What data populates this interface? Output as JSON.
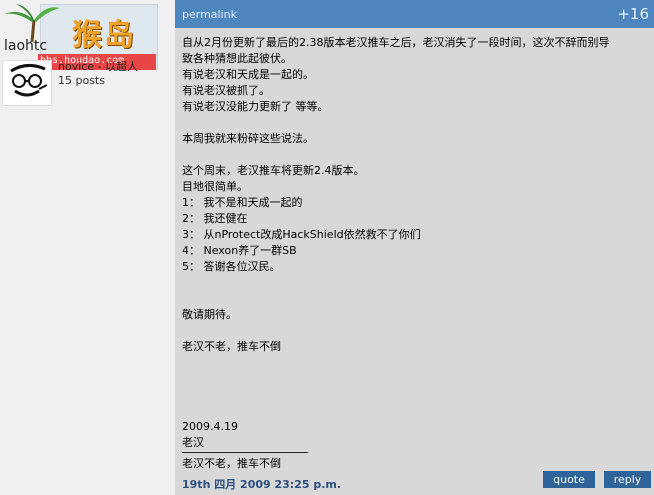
{
  "watermark": {
    "logo_text": "猴岛",
    "url": "bbs.houdao.com"
  },
  "user": {
    "name": "laohtc",
    "rank": "novice - 以超人",
    "posts": "15 posts"
  },
  "header": {
    "permalink": "permalink",
    "score": "+16"
  },
  "post": {
    "lines": [
      "自从2月份更新了最后的2.38版本老汉推车之后，老汉消失了一段时间，这次不辞而别导",
      "致各种猜想此起彼伏。",
      "有说老汉和天成是一起的。",
      "有说老汉被抓了。",
      "有说老汉没能力更新了 等等。",
      "",
      "本周我就来粉碎这些说法。",
      "",
      "这个周末，老汉推车将更新2.4版本。",
      "目地很简单。",
      "1： 我不是和天成一起的",
      "2： 我还健在",
      "3： 从nProtect改成HackShield依然救不了你们",
      "4： Nexon养了一群SB",
      "5： 答谢各位汉民。",
      "",
      "",
      "敬请期待。",
      "",
      "老汉不老，推车不倒",
      "",
      "",
      "",
      "",
      "2009.4.19",
      "老汉"
    ],
    "signature": "老汉不老，推车不倒",
    "date": "19th 四月  2009 23:25 p.m."
  },
  "buttons": {
    "quote": "quote",
    "reply": "reply"
  },
  "colors": {
    "header": "#4d86be",
    "post_bg": "#d8d8d8",
    "button": "#2f6399"
  }
}
